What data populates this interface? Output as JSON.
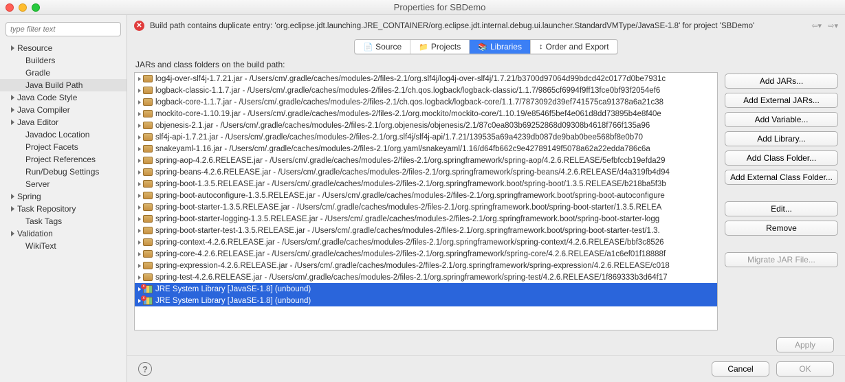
{
  "window": {
    "title": "Properties for SBDemo"
  },
  "filter": {
    "placeholder": "type filter text"
  },
  "sidebar": {
    "items": [
      {
        "label": "Resource",
        "hasChildren": true
      },
      {
        "label": "Builders",
        "hasChildren": false,
        "child": true
      },
      {
        "label": "Gradle",
        "hasChildren": false,
        "child": true
      },
      {
        "label": "Java Build Path",
        "hasChildren": false,
        "child": true,
        "selected": true
      },
      {
        "label": "Java Code Style",
        "hasChildren": true
      },
      {
        "label": "Java Compiler",
        "hasChildren": true
      },
      {
        "label": "Java Editor",
        "hasChildren": true
      },
      {
        "label": "Javadoc Location",
        "hasChildren": false,
        "child": true
      },
      {
        "label": "Project Facets",
        "hasChildren": false,
        "child": true
      },
      {
        "label": "Project References",
        "hasChildren": false,
        "child": true
      },
      {
        "label": "Run/Debug Settings",
        "hasChildren": false,
        "child": true
      },
      {
        "label": "Server",
        "hasChildren": false,
        "child": true
      },
      {
        "label": "Spring",
        "hasChildren": true
      },
      {
        "label": "Task Repository",
        "hasChildren": true
      },
      {
        "label": "Task Tags",
        "hasChildren": false,
        "child": true
      },
      {
        "label": "Validation",
        "hasChildren": true
      },
      {
        "label": "WikiText",
        "hasChildren": false,
        "child": true
      }
    ]
  },
  "error": {
    "message": "Build path contains duplicate entry: 'org.eclipse.jdt.launching.JRE_CONTAINER/org.eclipse.jdt.internal.debug.ui.launcher.StandardVMType/JavaSE-1.8' for project 'SBDemo'"
  },
  "tabs": [
    {
      "label": "Source",
      "active": false
    },
    {
      "label": "Projects",
      "active": false
    },
    {
      "label": "Libraries",
      "active": true
    },
    {
      "label": "Order and Export",
      "active": false
    }
  ],
  "listTitle": "JARs and class folders on the build path:",
  "jars": [
    {
      "text": "log4j-over-slf4j-1.7.21.jar - /Users/cm/.gradle/caches/modules-2/files-2.1/org.slf4j/log4j-over-slf4j/1.7.21/b3700d97064d99bdcd42c0177d0be7931c"
    },
    {
      "text": "logback-classic-1.1.7.jar - /Users/cm/.gradle/caches/modules-2/files-2.1/ch.qos.logback/logback-classic/1.1.7/9865cf6994f9ff13fce0bf93f2054ef6"
    },
    {
      "text": "logback-core-1.1.7.jar - /Users/cm/.gradle/caches/modules-2/files-2.1/ch.qos.logback/logback-core/1.1.7/7873092d39ef741575ca91378a6a21c38"
    },
    {
      "text": "mockito-core-1.10.19.jar - /Users/cm/.gradle/caches/modules-2/files-2.1/org.mockito/mockito-core/1.10.19/e8546f5bef4e061d8dd73895b4e8f40e"
    },
    {
      "text": "objenesis-2.1.jar - /Users/cm/.gradle/caches/modules-2/files-2.1/org.objenesis/objenesis/2.1/87c0ea803b69252868d09308b4618f766f135a96"
    },
    {
      "text": "slf4j-api-1.7.21.jar - /Users/cm/.gradle/caches/modules-2/files-2.1/org.slf4j/slf4j-api/1.7.21/139535a69a4239db087de9bab0bee568bf8e0b70"
    },
    {
      "text": "snakeyaml-1.16.jar - /Users/cm/.gradle/caches/modules-2/files-2.1/org.yaml/snakeyaml/1.16/d64fb662c9e42789149f5078a62a22edda786c6a"
    },
    {
      "text": "spring-aop-4.2.6.RELEASE.jar - /Users/cm/.gradle/caches/modules-2/files-2.1/org.springframework/spring-aop/4.2.6.RELEASE/5efbfccb19efda29"
    },
    {
      "text": "spring-beans-4.2.6.RELEASE.jar - /Users/cm/.gradle/caches/modules-2/files-2.1/org.springframework/spring-beans/4.2.6.RELEASE/d4a319fb4d94"
    },
    {
      "text": "spring-boot-1.3.5.RELEASE.jar - /Users/cm/.gradle/caches/modules-2/files-2.1/org.springframework.boot/spring-boot/1.3.5.RELEASE/b218ba5f3b"
    },
    {
      "text": "spring-boot-autoconfigure-1.3.5.RELEASE.jar - /Users/cm/.gradle/caches/modules-2/files-2.1/org.springframework.boot/spring-boot-autoconfigure"
    },
    {
      "text": "spring-boot-starter-1.3.5.RELEASE.jar - /Users/cm/.gradle/caches/modules-2/files-2.1/org.springframework.boot/spring-boot-starter/1.3.5.RELEA"
    },
    {
      "text": "spring-boot-starter-logging-1.3.5.RELEASE.jar - /Users/cm/.gradle/caches/modules-2/files-2.1/org.springframework.boot/spring-boot-starter-logg"
    },
    {
      "text": "spring-boot-starter-test-1.3.5.RELEASE.jar - /Users/cm/.gradle/caches/modules-2/files-2.1/org.springframework.boot/spring-boot-starter-test/1.3."
    },
    {
      "text": "spring-context-4.2.6.RELEASE.jar - /Users/cm/.gradle/caches/modules-2/files-2.1/org.springframework/spring-context/4.2.6.RELEASE/bbf3c8526"
    },
    {
      "text": "spring-core-4.2.6.RELEASE.jar - /Users/cm/.gradle/caches/modules-2/files-2.1/org.springframework/spring-core/4.2.6.RELEASE/a1c6ef01f18888f"
    },
    {
      "text": "spring-expression-4.2.6.RELEASE.jar - /Users/cm/.gradle/caches/modules-2/files-2.1/org.springframework/spring-expression/4.2.6.RELEASE/c018"
    },
    {
      "text": "spring-test-4.2.6.RELEASE.jar - /Users/cm/.gradle/caches/modules-2/files-2.1/org.springframework/spring-test/4.2.6.RELEASE/1f869333b3d64f17"
    }
  ],
  "jreEntries": [
    {
      "text": "JRE System Library [JavaSE-1.8] (unbound)"
    },
    {
      "text": "JRE System Library [JavaSE-1.8] (unbound)"
    }
  ],
  "buttons": {
    "addJars": "Add JARs...",
    "addExtJars": "Add External JARs...",
    "addVar": "Add Variable...",
    "addLib": "Add Library...",
    "addClassFolder": "Add Class Folder...",
    "addExtClassFolder": "Add External Class Folder...",
    "edit": "Edit...",
    "remove": "Remove",
    "migrate": "Migrate JAR File...",
    "apply": "Apply",
    "cancel": "Cancel",
    "ok": "OK"
  }
}
